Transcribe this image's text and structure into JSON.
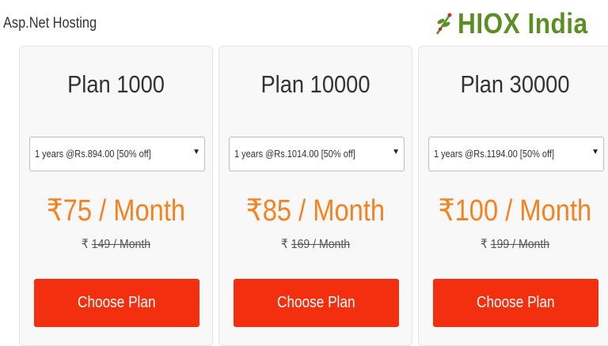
{
  "header": {
    "site_title": "Asp.Net Hosting",
    "logo_text": "HIOX India",
    "brand_color": "#5b8f23"
  },
  "accent_color": "#f58220",
  "button_color": "#f2300f",
  "plans": [
    {
      "name": "Plan 1000",
      "selected_option": "1 years @Rs.894.00 [50% off]",
      "currency": "₹",
      "price": "75 / Month",
      "old_price": "149 / Month",
      "button_label": "Choose Plan"
    },
    {
      "name": "Plan 10000",
      "selected_option": "1 years @Rs.1014.00 [50% off]",
      "currency": "₹",
      "price": "85 / Month",
      "old_price": "169 / Month",
      "button_label": "Choose Plan"
    },
    {
      "name": "Plan 30000",
      "selected_option": "1 years @Rs.1194.00 [50% off]",
      "currency": "₹",
      "price": "100 / Month",
      "old_price": "199 / Month",
      "button_label": "Choose Plan"
    }
  ]
}
